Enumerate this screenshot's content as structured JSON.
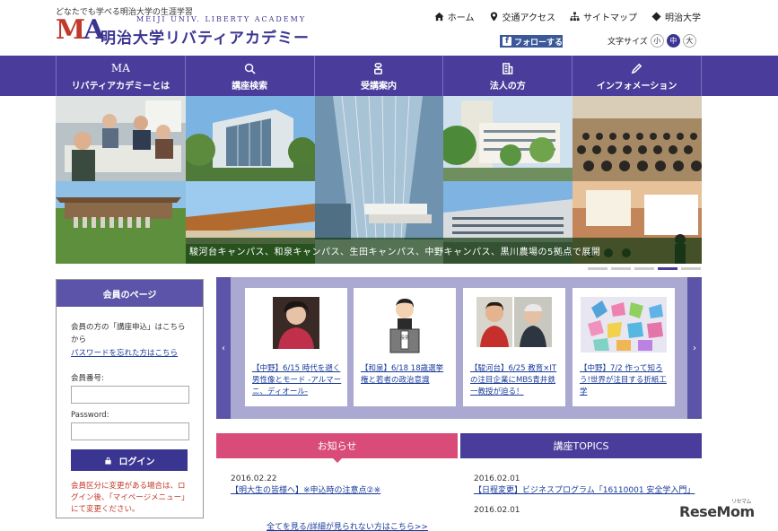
{
  "header": {
    "tagline": "どなたでも学べる明治大学の生涯学習",
    "logo_mark_m": "M",
    "logo_mark_a": "A",
    "logo_en": "MEIJI UNIV. LIBERTY ACADEMY",
    "logo_ja": "明治大学リバティアカデミー",
    "util": {
      "home": "ホーム",
      "access": "交通アクセス",
      "sitemap": "サイトマップ",
      "meiji": "明治大学"
    },
    "facebook_label": "フォローする",
    "facebook_letter": "f",
    "font_size_label": "文字サイズ",
    "font_sizes": [
      "小",
      "中",
      "大"
    ]
  },
  "nav": {
    "items": [
      {
        "icon_text": "MA",
        "label": "リバティアカデミーとは"
      },
      {
        "label": "講座検索"
      },
      {
        "label": "受講案内"
      },
      {
        "label": "法人の方"
      },
      {
        "label": "インフォメーション"
      }
    ]
  },
  "hero": {
    "caption": "駿河台キャンパス、和泉キャンパス、生田キャンパス、中野キャンパス、黒川農場の5拠点で展開",
    "active_slide": 3,
    "slide_count": 5
  },
  "member": {
    "title": "会員のページ",
    "intro": "会員の方の「講座申込」はこちらから",
    "forgot_link": "パスワードを忘れた方はこちら",
    "id_label": "会員番号:",
    "id_value": "",
    "pw_label": "Password:",
    "pw_value": "",
    "login_label": "ログイン",
    "warning": "会員区分に変更がある場合は、ログイン後、「マイページメニュー」にて変更ください。"
  },
  "carousel": {
    "prev": "‹",
    "next": "›",
    "cards": [
      {
        "text": "【中野】6/15 時代を遡く男性像とモード -アルマーニ、ディオール-"
      },
      {
        "text": "【和泉】6/18 18歳選挙権と若者の政治意識",
        "ballot_label": "投票"
      },
      {
        "text": "【駿河台】6/25 教育×ITの注目企業にMBS青井鉄一教授が迫る！"
      },
      {
        "text": "【中野】7/2 作って知ろう!世界が注目する折紙工学"
      }
    ]
  },
  "news": {
    "tab_notice": "お知らせ",
    "tab_topics": "講座TOPICS",
    "notice_items": [
      {
        "date": "2016.02.22",
        "text": "【明大生の皆様へ】※申込時の注意点②※"
      }
    ],
    "topics_items": [
      {
        "date": "2016.02.01",
        "text": "【日程変更】ビジネスプログラム「16110001 安全学入門」"
      },
      {
        "date": "2016.02.01",
        "text": ""
      }
    ],
    "more_link": "全てを見る/詳細が見られない方はこちら>>"
  },
  "watermark": {
    "text": "ReseMom",
    "small": "リセマム"
  },
  "colors": {
    "brand_purple": "#4a3c9a",
    "pink": "#d94c7a",
    "carousel_bg": "#aba9d2"
  }
}
